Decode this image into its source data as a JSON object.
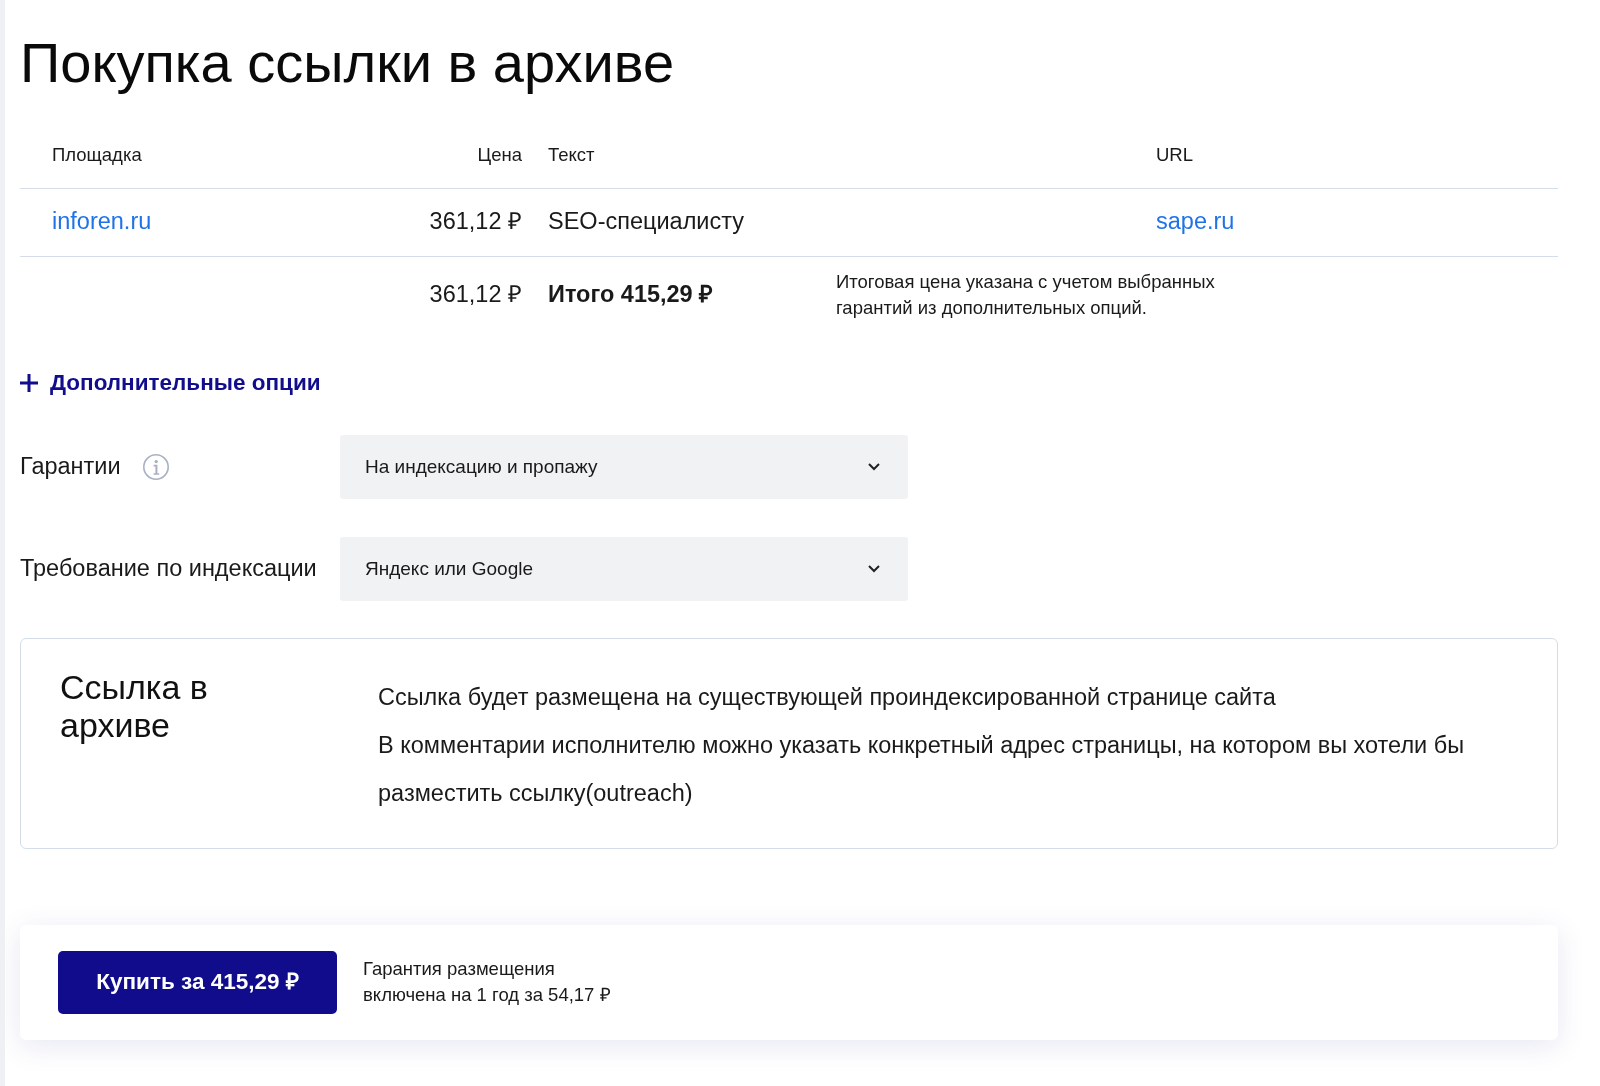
{
  "title": "Покупка ссылки в архиве",
  "table": {
    "columns": [
      "Площадка",
      "Цена",
      "Текст",
      "URL"
    ],
    "rows": [
      {
        "site": "inforen.ru",
        "price": "361,12 ₽",
        "text": "SEO-специалисту",
        "url": "sape.ru"
      }
    ],
    "summary": {
      "price": "361,12 ₽",
      "total": "Итого 415,29 ₽",
      "note": [
        "Итоговая цена указана с учетом выбранных",
        "гарантий из дополнительных опций."
      ]
    }
  },
  "options": {
    "toggle": "Дополнительные опции",
    "fields": [
      {
        "label": "Гарантии",
        "info": true,
        "value": "На индексацию и пропажу"
      },
      {
        "label": "Требование по индексации",
        "info": false,
        "value": "Яндекс или Google"
      }
    ]
  },
  "info_card": {
    "title": "Ссылка в архиве",
    "paragraphs": [
      "Ссылка будет размещена на существующей проиндексированной странице сайта",
      "В комментарии исполнителю можно указать конкретный адрес страницы, на котором вы хотели бы разместить ссылку(outreach)"
    ]
  },
  "purchase_bar": {
    "button": "Купить за 415,29 ₽",
    "note": [
      "Гарантия размещения",
      "включена на 1 год за 54,17 ₽"
    ]
  }
}
